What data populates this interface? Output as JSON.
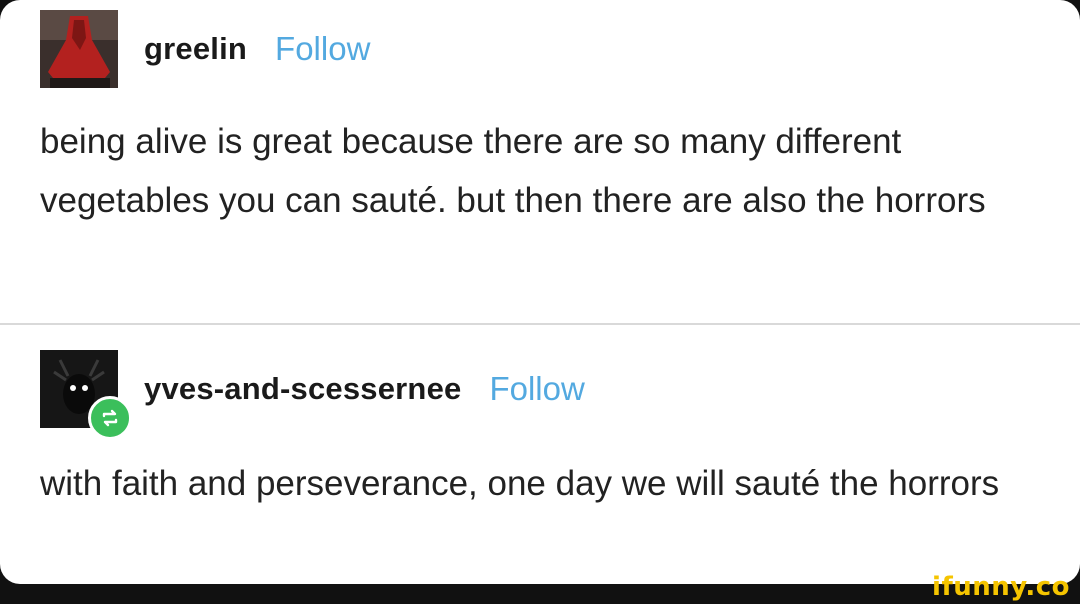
{
  "posts": [
    {
      "username": "greelin",
      "follow_label": "Follow",
      "text": "being alive is great because there are so many different vegetables you can sauté.  but then there are also the horrors"
    },
    {
      "username": "yves-and-scessernee",
      "follow_label": "Follow",
      "reblog_icon": "reblog-icon",
      "text": "with faith and perseverance, one day we will sauté the horrors"
    }
  ],
  "watermark": "ifunny.co",
  "colors": {
    "follow": "#53a9e0",
    "reblog_badge": "#3bbf5b",
    "watermark": "#f5c400"
  }
}
